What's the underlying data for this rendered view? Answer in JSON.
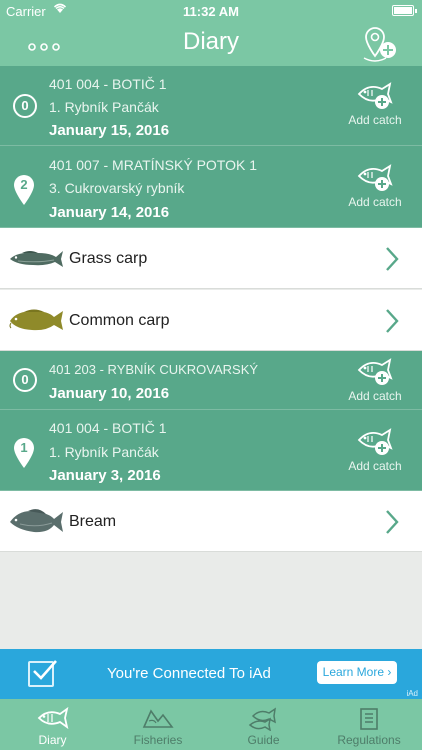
{
  "status_bar": {
    "carrier": "Carrier",
    "time": "11:32 AM"
  },
  "nav": {
    "title": "Diary",
    "more_icon": "ellipsis-icon",
    "location_icon": "location-add-icon"
  },
  "entries": [
    {
      "badge": "0",
      "badge_type": "circle",
      "code": "401 004 - BOTIČ 1",
      "sub": "1. Rybník Pančák",
      "date": "January 15, 2016",
      "action": "Add catch"
    },
    {
      "badge": "2",
      "badge_type": "pin",
      "code": "401 007 - MRATÍNSKÝ POTOK 1",
      "sub": "3. Cukrovarský rybník",
      "date": "January 14, 2016",
      "action": "Add catch"
    },
    {
      "badge": "0",
      "badge_type": "circle",
      "code": "401 203 - RYBNÍK CUKROVARSKÝ",
      "date": "January 10, 2016",
      "action": "Add catch"
    },
    {
      "badge": "1",
      "badge_type": "pin",
      "code": "401 004 - BOTIČ 1",
      "sub": "1. Rybník Pančák",
      "date": "January 3, 2016",
      "action": "Add catch"
    }
  ],
  "catches": [
    {
      "name": "Grass carp",
      "color": "#4f6b61"
    },
    {
      "name": "Common carp",
      "color": "#8f8a2a"
    },
    {
      "name": "Bream",
      "color": "#5a6e6c"
    }
  ],
  "ad": {
    "text": "You're Connected To iAd",
    "button": "Learn More ›",
    "tag": "iAd"
  },
  "tabs": [
    {
      "label": "Diary",
      "icon": "fish-icon",
      "active": true
    },
    {
      "label": "Fisheries",
      "icon": "map-icon",
      "active": false
    },
    {
      "label": "Guide",
      "icon": "fish-guide-icon",
      "active": false
    },
    {
      "label": "Regulations",
      "icon": "document-icon",
      "active": false
    }
  ],
  "colors": {
    "header": "#7bc7a4",
    "diary_row": "#58a88a",
    "ad": "#2aa7dc"
  }
}
